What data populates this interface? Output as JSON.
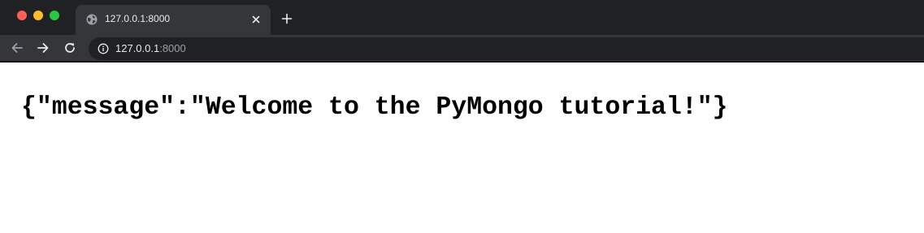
{
  "window": {
    "traffic_lights": {
      "close_color": "#ff5f57",
      "minimize_color": "#febc2e",
      "maximize_color": "#28c840"
    }
  },
  "tab": {
    "title": "127.0.0.1:8000",
    "icon": "globe-icon",
    "close_icon": "close-icon"
  },
  "new_tab_icon": "plus-icon",
  "toolbar": {
    "back_icon": "arrow-left-icon",
    "forward_icon": "arrow-right-icon",
    "reload_icon": "reload-icon",
    "address": {
      "info_icon": "info-icon",
      "host": "127.0.0.1",
      "port": ":8000"
    }
  },
  "page": {
    "body_text": "{\"message\":\"Welcome to the PyMongo tutorial!\"}"
  },
  "colors": {
    "chrome_bg": "#202124",
    "tab_active_bg": "#35363a",
    "text_primary": "#e8eaed",
    "text_muted": "#9aa0a6",
    "page_bg": "#ffffff"
  }
}
